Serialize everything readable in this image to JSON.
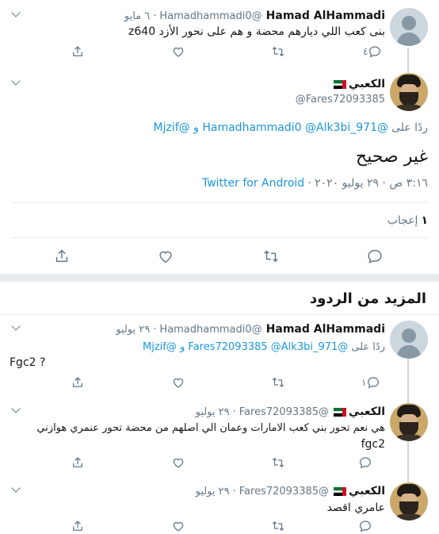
{
  "top_reply": {
    "name": "Hamad AlHammadi",
    "handle": "@Hamadhammadi0",
    "dot": "·",
    "date": "٦ مايو",
    "text": "بنى كعب اللي ديارهم محضة و هم على نحور الأزد z640",
    "reply_count": "٤"
  },
  "main_tweet": {
    "name": "الكعبي",
    "handle": "@Fares72093385",
    "replying_to_label": "ردًا على",
    "replying_to": "@Hamadhammadi0 @Alk3bi_971 و @Mjzif",
    "text": "غير صحيح",
    "time": "٣:١٦ ص · ٢٩ يوليو ٢٠٢٠ · ",
    "source": "Twitter for Android",
    "likes_count": "١",
    "likes_label": "إعجاب"
  },
  "more_replies": {
    "heading": "المزيد من الردود"
  },
  "replies": [
    {
      "name": "Hamad AlHammadi",
      "handle": "@Hamadhammadi0",
      "dot": "·",
      "date": "٢٩ يوليو",
      "replying_to_label": "ردًا على",
      "replying_to": "@Fares72093385 @Alk3bi_971 و @Mjzif",
      "text": "Fgc2 ?",
      "reply_count": "١"
    },
    {
      "name": "الكعبي",
      "handle": "@Fares72093385",
      "dot": "·",
      "date": "٢٩ يوليو",
      "text_line1": "هي نعم تحور بني كعب الامارات وعمان الي اصلهم من محضة تحور عنمري هوازني",
      "text_line2": "fgc2"
    },
    {
      "name": "الكعبي",
      "handle": "@Fares72093385",
      "dot": "·",
      "date": "٢٩ يوليو",
      "text": "عامري اقصد"
    }
  ],
  "icons": {
    "reply": "reply-icon",
    "retweet": "retweet-icon",
    "like": "heart-icon",
    "share": "share-icon",
    "menu": "chevron-down-icon"
  },
  "colors": {
    "accent": "#1b95e0",
    "muted": "#657786",
    "divider": "#e6ecf0"
  }
}
